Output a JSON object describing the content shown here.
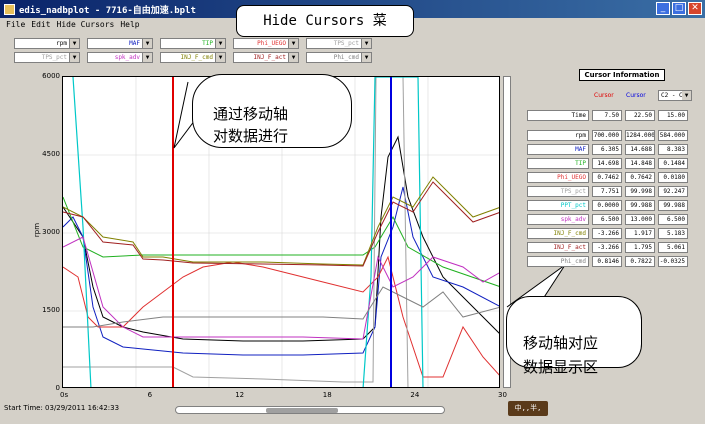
{
  "window": {
    "title": "edis_nadbplot - 7716-自由加速.bplt"
  },
  "menu": {
    "items": [
      "File",
      "Edit",
      "Hide Cursors",
      "Help"
    ]
  },
  "callouts": {
    "hide_cursors": "Hide Cursors 菜",
    "move_axis": "通过移动轴\n对数据进行\n分析",
    "display_area": "移动轴对应\n数据显示区"
  },
  "signals_row1": [
    "rpm",
    "MAF",
    "TIP",
    "Phi_UEGO",
    "TPS_pct"
  ],
  "signals_row2": [
    "TPS_pct",
    "spk_adv",
    "INJ_F_cmd",
    "INJ_F_act",
    "Phi_cmd"
  ],
  "plot": {
    "ylabel": "rpm",
    "yticks": [
      "6000",
      "4500",
      "3000",
      "1500",
      "0"
    ],
    "xticks": [
      "0s",
      "6",
      "12",
      "18",
      "24",
      "30"
    ],
    "start_time": "Start Time: 03/29/2011 16:42:33"
  },
  "cursor_info": {
    "title": "Cursor Information",
    "cursor1": "Cursor",
    "cursor2": "Cursor",
    "diff_select": "C2 - C1",
    "rows": [
      {
        "name": "Time",
        "c1": "7.50",
        "c2": "22.50",
        "d": "15.00",
        "color": "#000000"
      },
      {
        "name": "rpm",
        "c1": "700.000",
        "c2": "1284.000",
        "d": "584.000",
        "color": "#000000"
      },
      {
        "name": "MAF",
        "c1": "6.305",
        "c2": "14.688",
        "d": "8.383",
        "color": "#1020c0"
      },
      {
        "name": "TIP",
        "c1": "14.698",
        "c2": "14.848",
        "d": "0.1484",
        "color": "#20b020"
      },
      {
        "name": "Phi_UEGO",
        "c1": "0.7462",
        "c2": "0.7642",
        "d": "0.0180",
        "color": "#e03030"
      },
      {
        "name": "TPS_pct",
        "c1": "7.751",
        "c2": "99.998",
        "d": "92.247",
        "color": "#a0a0a0"
      },
      {
        "name": "PPT_pct",
        "c1": "0.0000",
        "c2": "99.988",
        "d": "99.988",
        "color": "#00c8c8"
      },
      {
        "name": "spk_adv",
        "c1": "6.500",
        "c2": "13.000",
        "d": "6.500",
        "color": "#c030c0"
      },
      {
        "name": "INJ_F_cmd",
        "c1": "-3.266",
        "c2": "1.917",
        "d": "5.183",
        "color": "#808000"
      },
      {
        "name": "INJ_F_act",
        "c1": "-3.266",
        "c2": "1.795",
        "d": "5.061",
        "color": "#a02020"
      },
      {
        "name": "Phi_cmd",
        "c1": "0.8146",
        "c2": "0.7822",
        "d": "-0.0325",
        "color": "#808080"
      }
    ]
  },
  "badge": {
    "label": "中,,半,"
  },
  "colors": {
    "cursor1": "#e00000",
    "cursor2": "#0000e0"
  }
}
